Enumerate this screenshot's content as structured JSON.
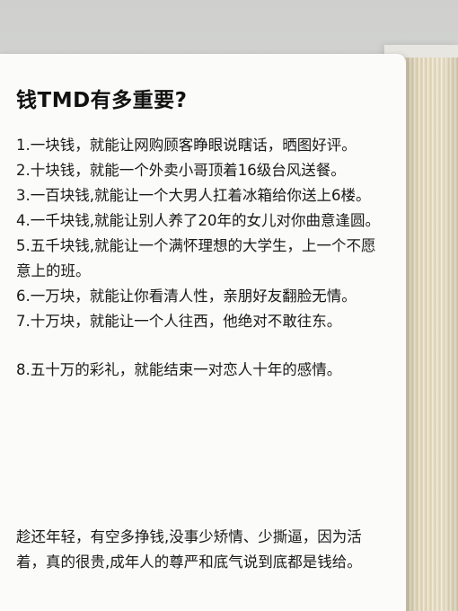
{
  "title": "钱TMD有多重要?",
  "items": [
    "1.一块钱，就能让网购顾客睁眼说瞎话，晒图好评。",
    "2.十块钱，就能一个外卖小哥顶着16级台风送餐。",
    "3.一百块钱,就能让一个大男人扛着冰箱给你送上6楼。",
    "4.一千块钱,就能让别人养了20年的女儿对你曲意逢圆。",
    "5.五千块钱,就能让一个满怀理想的大学生，上一个不愿意上的班。",
    "6.一万块，就能让你看清人性，亲朋好友翻脸无情。",
    "7.十万块，就能让一个人往西，他绝对不敢往东。",
    "8.五十万的彩礼，就能结束一对恋人十年的感情。"
  ],
  "closing": "趁还年轻，有空多挣钱,没事少矫情、少撕逼，因为活着，真的很贵,成年人的尊严和底气说到底都是钱给。"
}
